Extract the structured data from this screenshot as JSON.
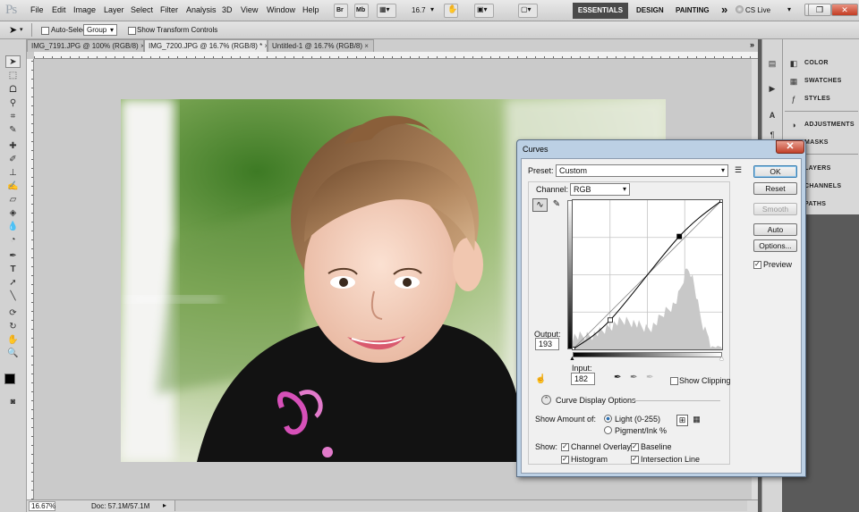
{
  "app": {
    "logo": "Ps"
  },
  "menu": [
    "File",
    "Edit",
    "Image",
    "Layer",
    "Select",
    "Filter",
    "Analysis",
    "3D",
    "View",
    "Window",
    "Help"
  ],
  "zoom_field": "16.7",
  "workspaces": [
    "ESSENTIALS",
    "DESIGN",
    "PAINTING"
  ],
  "workspace_more": "»",
  "cs_live": "CS Live",
  "options_bar": {
    "auto_select_label": "Auto-Select:",
    "auto_select_value": "Group",
    "show_transform_label": "Show Transform Controls"
  },
  "tabs": [
    {
      "label": "IMG_7191.JPG @ 100% (RGB/8)",
      "close": "×"
    },
    {
      "label": "IMG_7200.JPG @ 16.7% (RGB/8) *",
      "close": "×"
    },
    {
      "label": "Untitled-1 @ 16.7% (RGB/8)",
      "close": "×"
    }
  ],
  "status": {
    "zoom": "16.67%",
    "doc": "Doc: 57.1M/57.1M"
  },
  "panels": [
    "COLOR",
    "SWATCHES",
    "STYLES",
    "ADJUSTMENTS",
    "MASKS",
    "LAYERS",
    "CHANNELS",
    "PATHS"
  ],
  "curves": {
    "title": "Curves",
    "preset_label": "Preset:",
    "preset_value": "Custom",
    "channel_label": "Channel:",
    "channel_value": "RGB",
    "output_label": "Output:",
    "output_value": "193",
    "input_label": "Input:",
    "input_value": "182",
    "show_clipping": "Show Clipping",
    "display_options": "Curve Display Options",
    "show_amount_label": "Show Amount of:",
    "light_option": "Light  (0-255)",
    "pigment_option": "Pigment/Ink %",
    "show_label": "Show:",
    "channel_overlays": "Channel Overlays",
    "baseline": "Baseline",
    "histogram": "Histogram",
    "intersection_line": "Intersection Line",
    "buttons": {
      "ok": "OK",
      "reset": "Reset",
      "smooth": "Smooth",
      "auto": "Auto",
      "options": "Options..."
    },
    "preview": "Preview",
    "curve_points": [
      [
        0,
        0
      ],
      [
        64,
        50
      ],
      [
        182,
        193
      ],
      [
        255,
        255
      ]
    ]
  }
}
